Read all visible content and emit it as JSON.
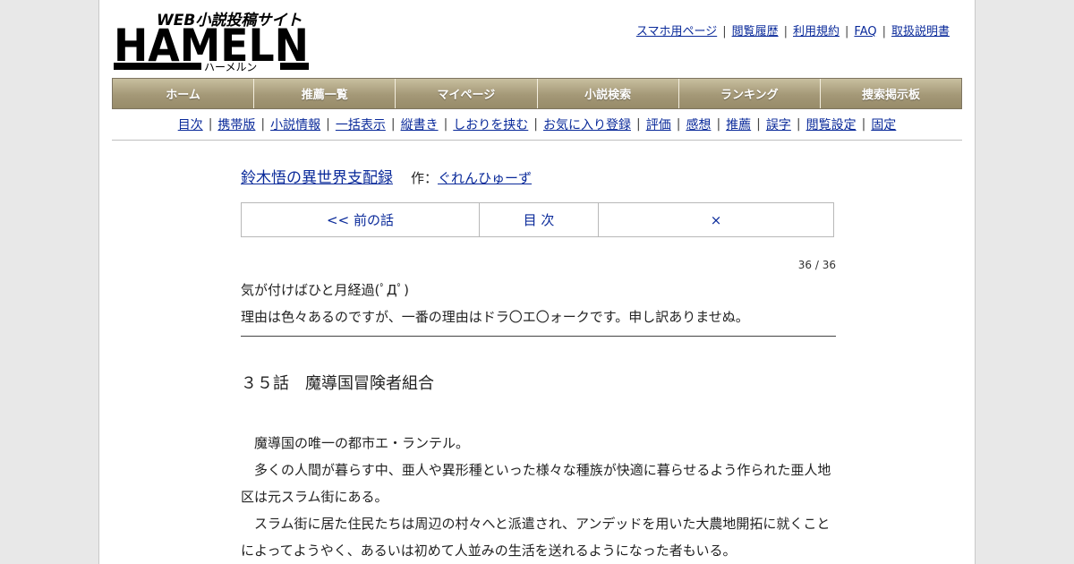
{
  "logo": {
    "main_text": "HAMELN",
    "tagline": "WEB小説投稿サイト",
    "kana": "ハーメルン"
  },
  "top_links": [
    "スマホ用ページ",
    "閲覧履歴",
    "利用規約",
    "FAQ",
    "取扱説明書"
  ],
  "main_nav": [
    "ホーム",
    "推薦一覧",
    "マイページ",
    "小説検索",
    "ランキング",
    "捜索掲示板"
  ],
  "sub_nav": [
    "目次",
    "携帯版",
    "小説情報",
    "一括表示",
    "縦書き",
    "しおりを挟む",
    "お気に入り登録",
    "評価",
    "感想",
    "推薦",
    "誤字",
    "閲覧設定",
    "固定"
  ],
  "novel": {
    "title": "鈴木悟の異世界支配録",
    "author_prefix": "作：",
    "author": "ぐれんひゅーず"
  },
  "pager": {
    "prev": "<< 前の話",
    "toc": "目 次",
    "next": "×"
  },
  "counter": "36 / 36",
  "preface": [
    "気が付けばひと月経過(ﾟДﾟ)",
    "理由は色々あるのですが、一番の理由はドラ〇エ〇ォークです。申し訳ありませぬ。"
  ],
  "chapter_title": "３５話　魔導国冒険者組合",
  "body": [
    "　魔導国の唯一の都市エ・ランテル。",
    "　多くの人間が暮らす中、亜人や異形種といった様々な種族が快適に暮らせるよう作られた亜人地区は元スラム街にある。",
    "　スラム街に居た住民たちは周辺の村々へと派遣され、アンデッドを用いた大農地開拓に就くことによってようやく、あるいは初めて人並みの生活を送れるようになった者もいる。"
  ]
}
